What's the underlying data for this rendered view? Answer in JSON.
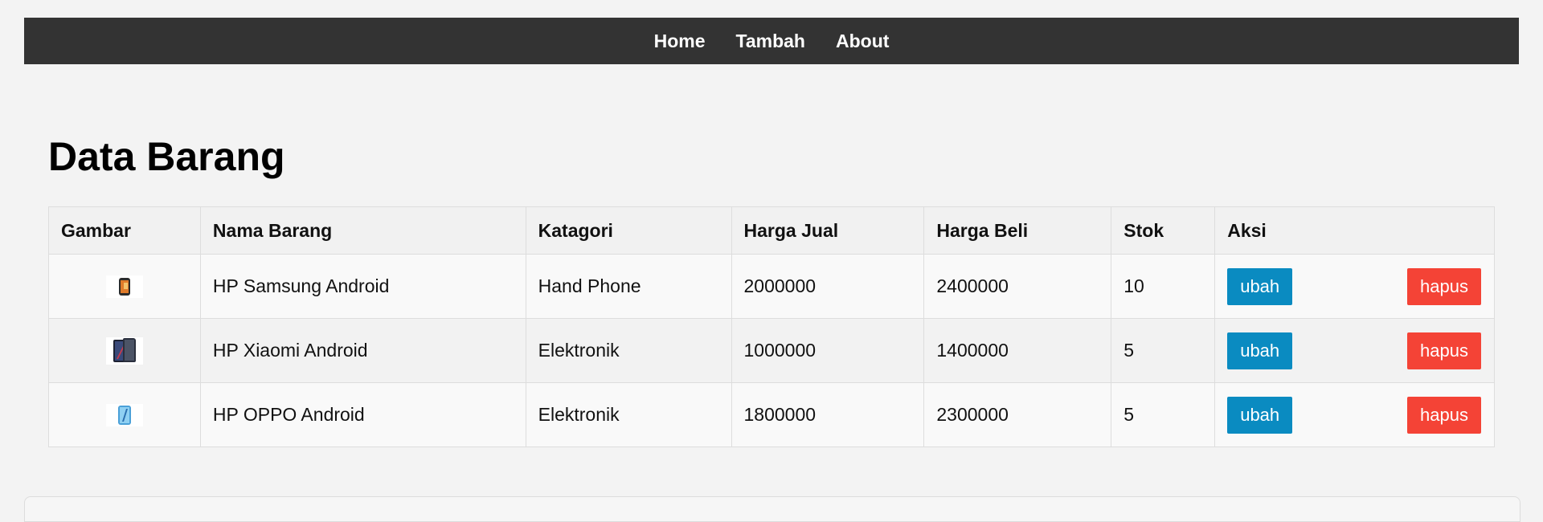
{
  "nav": {
    "items": [
      {
        "label": "Home"
      },
      {
        "label": "Tambah"
      },
      {
        "label": "About"
      }
    ]
  },
  "page": {
    "title": "Data Barang"
  },
  "table": {
    "headers": [
      "Gambar",
      "Nama Barang",
      "Katagori",
      "Harga Jual",
      "Harga Beli",
      "Stok",
      "Aksi"
    ],
    "rows": [
      {
        "nama": "HP Samsung Android",
        "kategori": "Hand Phone",
        "harga_jual": "2000000",
        "harga_beli": "2400000",
        "stok": "10",
        "ubah": "ubah",
        "hapus": "hapus"
      },
      {
        "nama": "HP Xiaomi Android",
        "kategori": "Elektronik",
        "harga_jual": "1000000",
        "harga_beli": "1400000",
        "stok": "5",
        "ubah": "ubah",
        "hapus": "hapus"
      },
      {
        "nama": "HP OPPO Android",
        "kategori": "Elektronik",
        "harga_jual": "1800000",
        "harga_beli": "2300000",
        "stok": "5",
        "ubah": "ubah",
        "hapus": "hapus"
      }
    ]
  },
  "colors": {
    "nav_bg": "#333333",
    "ubah": "#0a8bc1",
    "hapus": "#f44336"
  }
}
